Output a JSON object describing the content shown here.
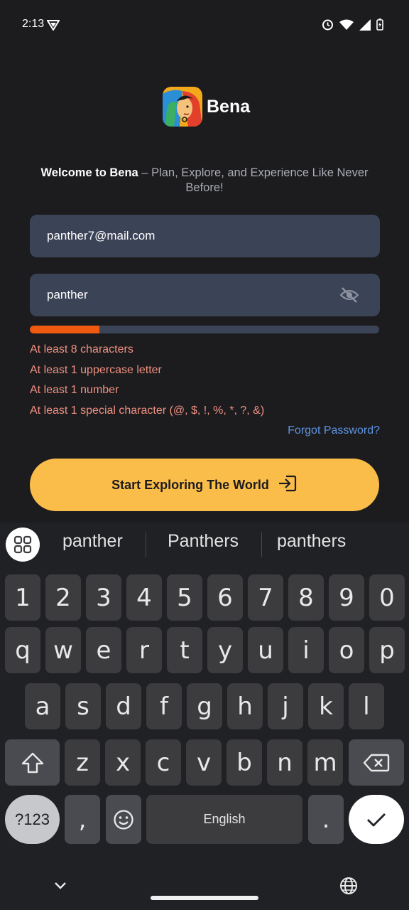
{
  "status_bar": {
    "time": "2:13",
    "icons": [
      "vpn-icon",
      "alarm-icon",
      "wifi-icon",
      "signal-icon",
      "battery-charging-icon"
    ]
  },
  "app": {
    "name": "Bena",
    "logo_icon": "bena-logo-icon"
  },
  "welcome": {
    "bold": "Welcome to Bena",
    "rest": " – Plan, Explore, and Experience Like Never Before!"
  },
  "form": {
    "email_value": "panther7@mail.com",
    "password_value": "panther",
    "password_toggle_icon": "eye-off-icon",
    "strength_fraction": 0.2,
    "strength_color": "#f05a10",
    "rules": [
      "At least 8 characters",
      "At least 1 uppercase letter",
      "At least 1 number",
      "At least 1 special character (@, $, !, %, *, ?, &)"
    ],
    "forgot_label": "Forgot Password?",
    "submit_label": "Start Exploring The World",
    "submit_icon": "login-arrow-icon"
  },
  "keyboard": {
    "suggestions": [
      "panther",
      "Panthers",
      "panthers"
    ],
    "row_numbers": [
      "1",
      "2",
      "3",
      "4",
      "5",
      "6",
      "7",
      "8",
      "9",
      "0"
    ],
    "row_1": [
      "q",
      "w",
      "e",
      "r",
      "t",
      "y",
      "u",
      "i",
      "o",
      "p"
    ],
    "row_2": [
      "a",
      "s",
      "d",
      "f",
      "g",
      "h",
      "j",
      "k",
      "l"
    ],
    "row_3": [
      "z",
      "x",
      "c",
      "v",
      "b",
      "n",
      "m"
    ],
    "symbols_label": "?123",
    "comma": ",",
    "space_label": "English",
    "period": "."
  },
  "colors": {
    "accent": "#fbbd4a",
    "field_bg": "#3b4357",
    "error_text": "#f09080",
    "link": "#5f93e0"
  }
}
